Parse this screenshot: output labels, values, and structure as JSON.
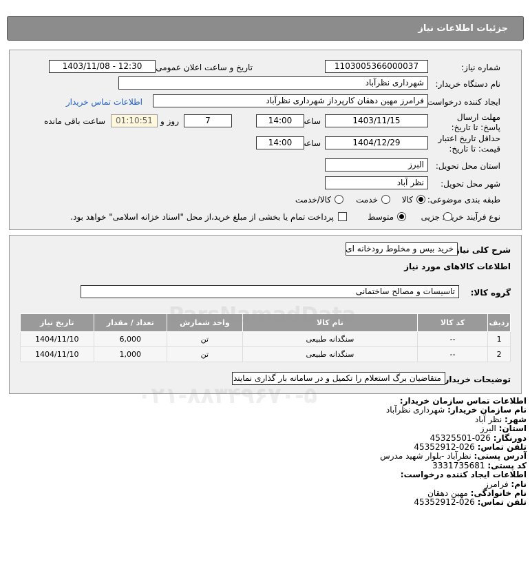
{
  "header": {
    "title": "جزئيات اطلاعات نياز"
  },
  "form": {
    "need_number_label": "شماره نیاز:",
    "need_number": "1103005366000037",
    "announce_label": "تاریخ و ساعت اعلان عمومی:",
    "announce_value": "1403/11/08 - 12:30",
    "buyer_label": "نام دستگاه خریدار:",
    "buyer_value": "شهرداری نظرآباد",
    "creator_label": "ایجاد کننده درخواست:",
    "creator_value": "فرامرز مهین دهقان کارپرداز شهرداری نظرآباد",
    "contact_link": "اطلاعات تماس خریدار",
    "deadline_label": "مهلت ارسال پاسخ: تا تاریخ:",
    "deadline_date": "1403/11/15",
    "time_label": "ساعت",
    "deadline_time": "14:00",
    "days_value": "7",
    "days_label": "روز و",
    "remaining_time": "01:10:51",
    "remaining_label": "ساعت باقی مانده",
    "validity_label": "حداقل تاریخ اعتبار قیمت: تا تاریخ:",
    "validity_date": "1404/12/29",
    "validity_time": "14:00",
    "province_label": "استان محل تحویل:",
    "province_value": "البرز",
    "city_label": "شهر محل تحویل:",
    "city_value": "نظر آباد",
    "category_label": "طبقه بندی موضوعی:",
    "category_options": [
      "کالا",
      "خدمت",
      "کالا/خدمت"
    ],
    "category_selected": "کالا",
    "process_label": "نوع فرآیند خرید :",
    "process_options": [
      "جزیی",
      "متوسط"
    ],
    "process_selected": "متوسط",
    "payment_note": "پرداخت تمام یا بخشی از مبلغ خرید،از محل \"اسناد خزانه اسلامی\" خواهد بود."
  },
  "section2": {
    "desc_label": "شرح کلی نیاز:",
    "desc_value": "خرید بیس و مخلوط رودخانه ای",
    "goods_title": "اطلاعات کالاهای مورد نیاز",
    "group_label": "گروه کالا:",
    "group_value": "تاسیسات و مصالح ساختمانی",
    "table": {
      "headers": [
        "ردیف",
        "کد کالا",
        "نام کالا",
        "واحد شمارش",
        "تعداد / مقدار",
        "تاریخ نیاز"
      ],
      "rows": [
        [
          "1",
          "--",
          "سنگدانه طبیعی",
          "تن",
          "6,000",
          "1404/11/10"
        ],
        [
          "2",
          "--",
          "سنگدانه طبیعی",
          "تن",
          "1,000",
          "1404/11/10"
        ]
      ]
    },
    "buyer_notes_label": "توضیحات خریدار:",
    "buyer_notes_value": "متقاضیان برگ استعلام را تکمیل و در سامانه بار گذاری نمایند"
  },
  "contact": {
    "org_title": "اطلاعات تماس سازمان خریدار:",
    "buyer_name_label": "نام سازمان خریدار:",
    "buyer_name": "شهرداری نظرآباد",
    "city_label": "شهر:",
    "city": "نظر آباد",
    "province_label": "استان:",
    "province": "البرز",
    "fax_label": "دورنگار:",
    "fax": "026-45325501",
    "phone_label": "تلفن تماس:",
    "phone": "026-45352912",
    "address_label": "آدرس پستی:",
    "address": "نظرآباد -بلوار شهید مدرس",
    "postal_label": "کد پستی:",
    "postal": "3331735681",
    "creator_title": "اطلاعات ایجاد کننده درخواست:",
    "first_name_label": "نام:",
    "first_name": "فرامرز",
    "last_name_label": "نام خانوادگی:",
    "last_name": "مهین دهقان",
    "creator_phone_label": "تلفن تماس:",
    "creator_phone": "026-45352912"
  },
  "watermark": {
    "brand": "ParsNamadData",
    "phone": "۰۲۱-۸۸۳۴۹۶۷۰-۵"
  }
}
